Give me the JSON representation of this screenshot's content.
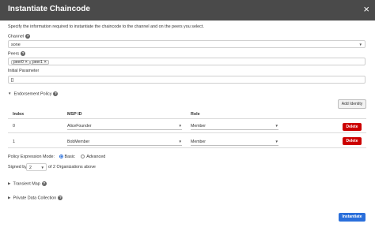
{
  "dialog": {
    "title": "Instantiate Chaincode",
    "description": "Specify the information required to instantiate the chaincode to the channel and on the peers you select.",
    "channel": {
      "label": "Channel",
      "value": "sone"
    },
    "peers": {
      "label": "Peers",
      "chips": [
        {
          "label": "peer0"
        },
        {
          "label": "peer1"
        }
      ]
    },
    "initial_parameter": {
      "label": "Initial Parameter",
      "value": "[]"
    },
    "endorsement_policy": {
      "label": "Endorsement Policy",
      "add_identity_label": "Add Identity",
      "columns": [
        "Index",
        "MSP ID",
        "Role"
      ],
      "rows": [
        {
          "index": "0",
          "msp_id": "AliceFounder",
          "role": "Member",
          "delete_label": "Delete"
        },
        {
          "index": "1",
          "msp_id": "BobMember",
          "role": "Member",
          "delete_label": "Delete"
        }
      ],
      "mode_label": "Policy Expression Mode:",
      "mode_basic": "Basic",
      "mode_advanced": "Advanced",
      "mode_selected": "Basic",
      "signed_by_label": "Signed by",
      "signed_by_value": "2",
      "signed_by_suffix": "of 2 Organizations above"
    },
    "transient_map": {
      "label": "Transient Map"
    },
    "private_data_collection": {
      "label": "Private Data Collection"
    },
    "instantiate_label": "Instantiate"
  },
  "colors": {
    "header_bg": "#4a4a4a",
    "primary": "#2a6fdb",
    "danger": "#cc0000"
  }
}
